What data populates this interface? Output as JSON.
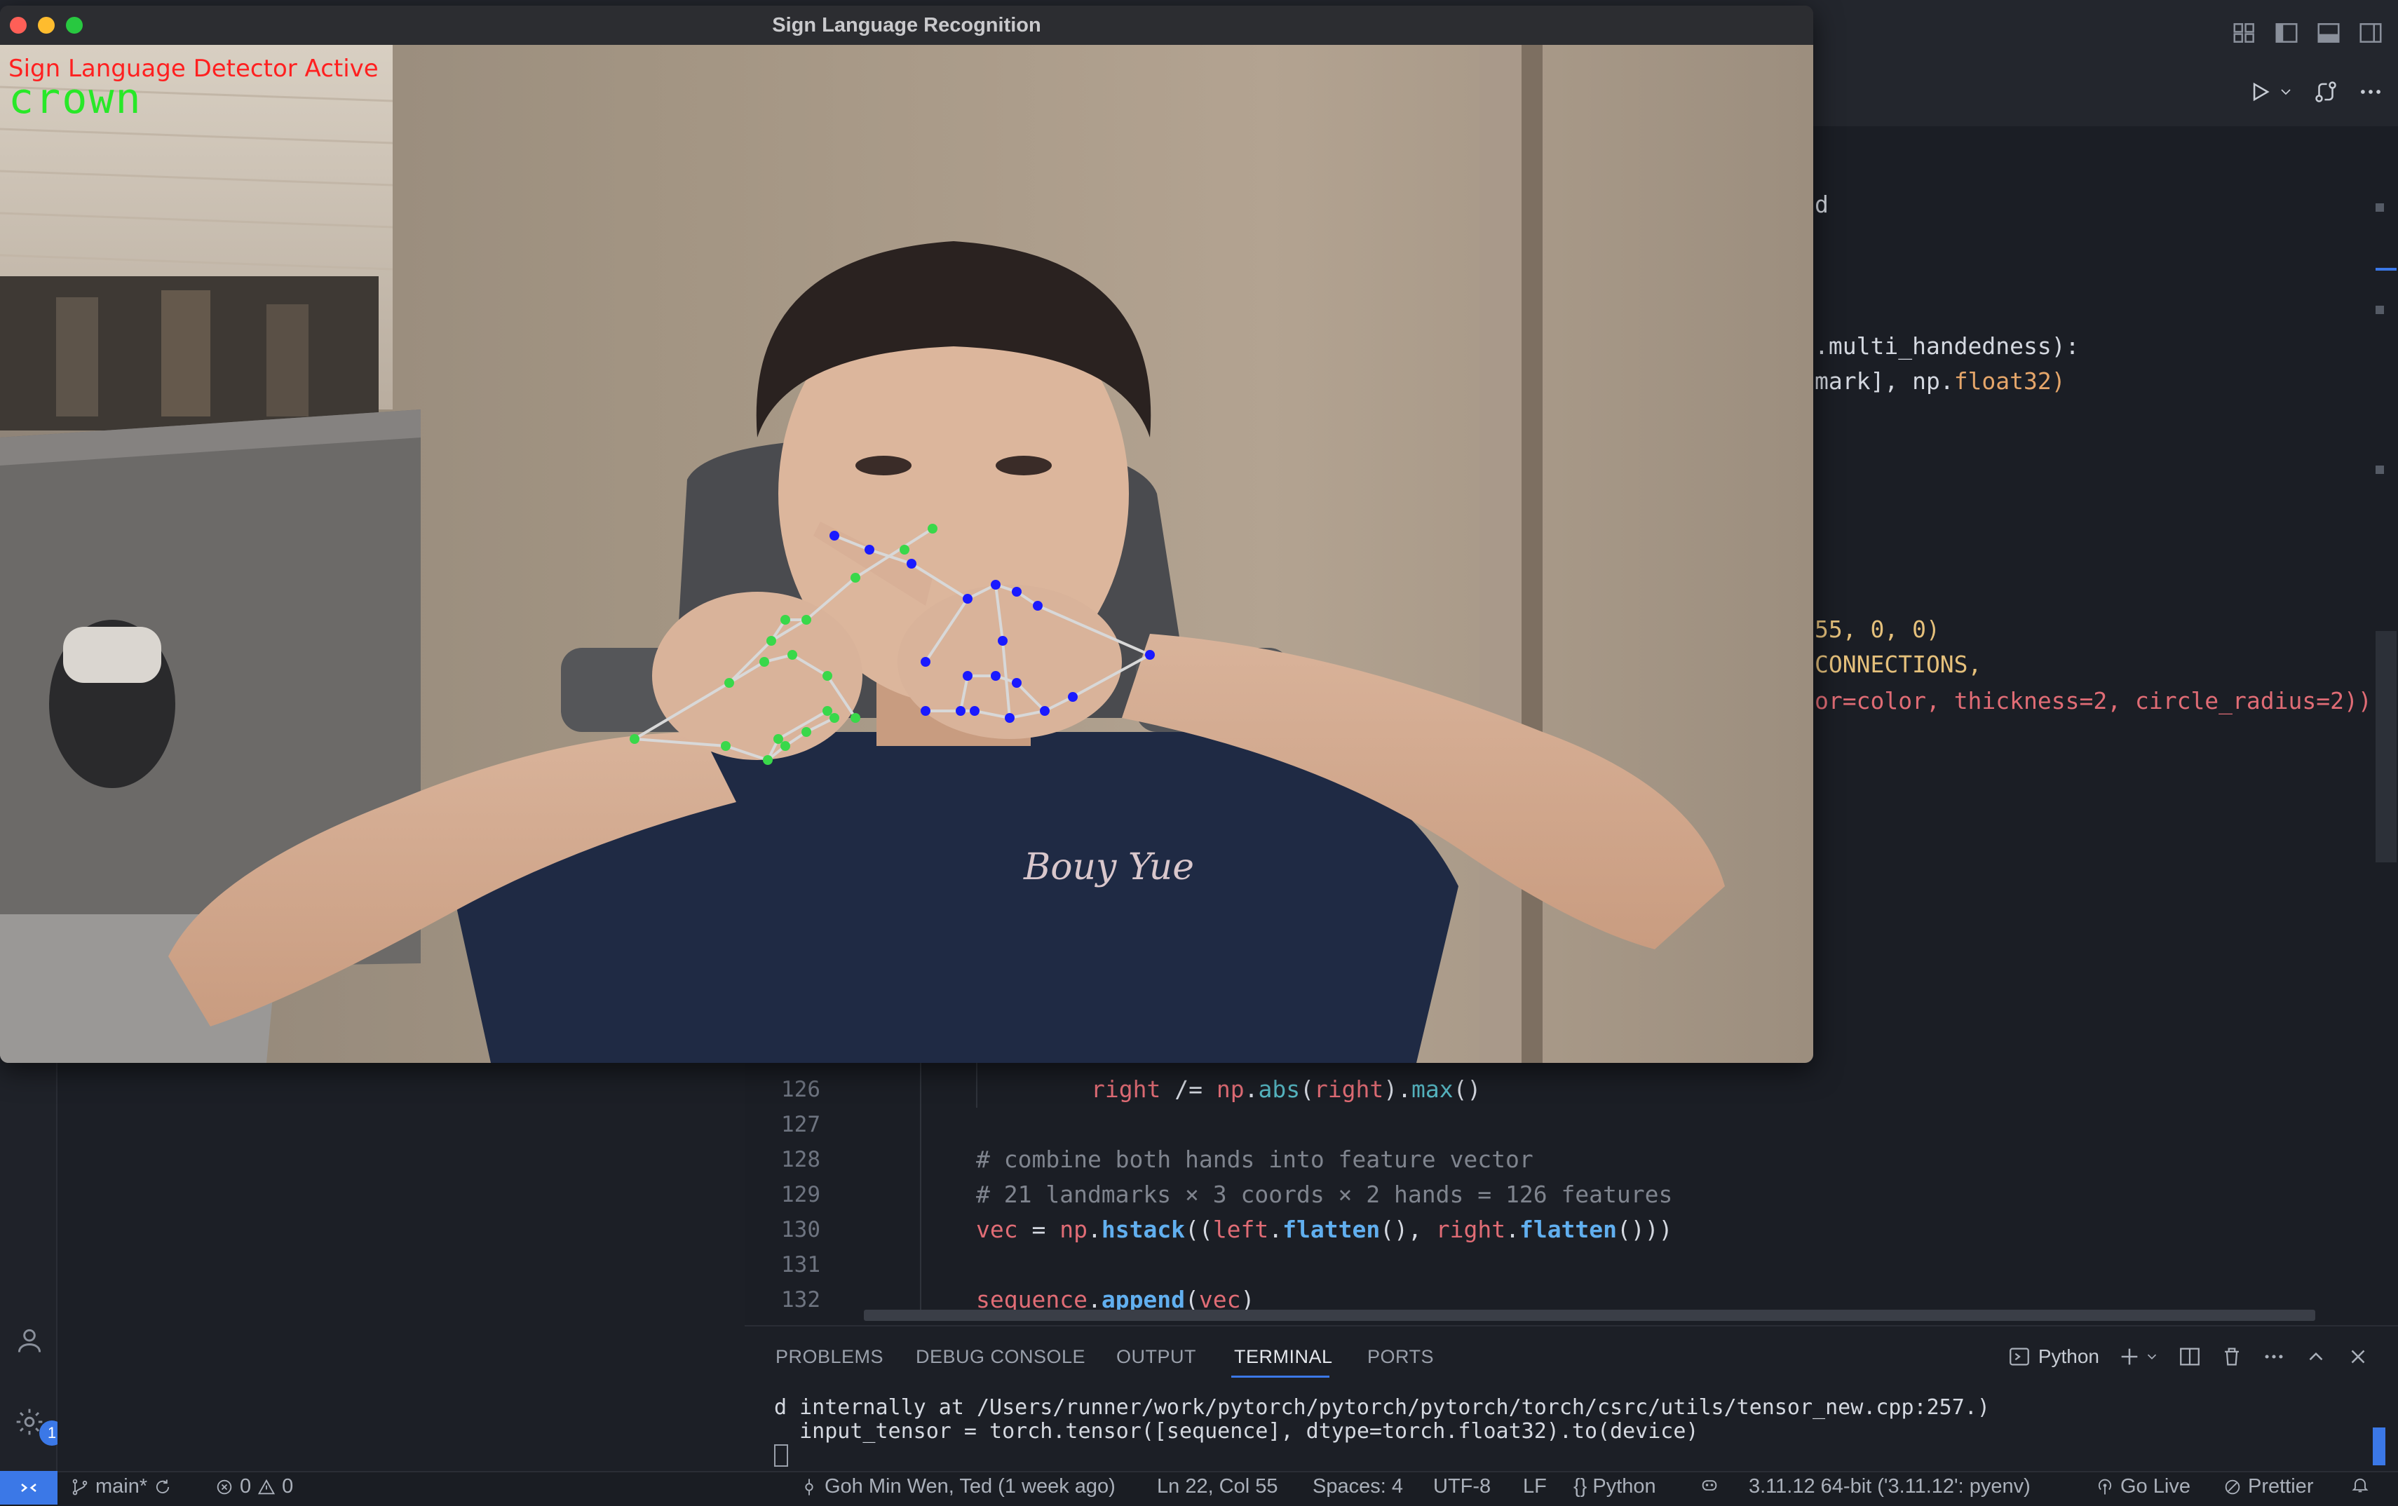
{
  "vscode": {
    "code": [
      {
        "ln": "126",
        "text": "right /= np.abs(right).max()"
      },
      {
        "ln": "127",
        "text": ""
      },
      {
        "ln": "128",
        "text": "# combine both hands into feature vector"
      },
      {
        "ln": "129",
        "text": "# 21 landmarks × 3 coords × 2 hands = 126 features"
      },
      {
        "ln": "130",
        "text": "vec = np.hstack((left.flatten(), right.flatten()))"
      },
      {
        "ln": "131",
        "text": ""
      },
      {
        "ln": "132",
        "text": "sequence.append(vec)"
      }
    ],
    "partial_code": {
      "line1": "d",
      "line2": ".multi_handedness):",
      "line3a": "mark], np.",
      "line3b": "float32)",
      "line4": "55, 0, 0)",
      "line5": "CONNECTIONS,",
      "line6a": "or=color, ",
      "line6b": "thickness=2, circle_radius=2))"
    },
    "panel": {
      "tabs": [
        "PROBLEMS",
        "DEBUG CONSOLE",
        "OUTPUT",
        "TERMINAL",
        "PORTS"
      ],
      "active_tab": "TERMINAL",
      "shell_label": "Python"
    },
    "terminal": [
      "d internally at /Users/runner/work/pytorch/pytorch/pytorch/torch/csrc/utils/tensor_new.cpp:257.)",
      "  input_tensor = torch.tensor([sequence], dtype=torch.float32).to(device)"
    ],
    "activity": {
      "settings_badge": "1"
    },
    "statusbar": {
      "branch": "main*",
      "errors": "0",
      "warnings": "0",
      "blame": "Goh Min Wen, Ted (1 week ago)",
      "cursor": "Ln 22, Col 55",
      "spaces": "Spaces: 4",
      "encoding": "UTF-8",
      "eol": "LF",
      "language": "Python",
      "interpreter": "3.11.12 64-bit ('3.11.12': pyenv)",
      "go_live": "Go Live",
      "prettier": "Prettier"
    }
  },
  "cv_window": {
    "title": "Sign Language Recognition",
    "overlay_status": "Sign Language Detector Active",
    "overlay_word": "crown",
    "shirt_text": "Bouy Yue"
  },
  "colors": {
    "accent": "#3b78e7",
    "overlay_status": "#ff2020",
    "overlay_word": "#28e828",
    "landmark_left": "#39d84a",
    "landmark_right": "#1a1aff"
  }
}
